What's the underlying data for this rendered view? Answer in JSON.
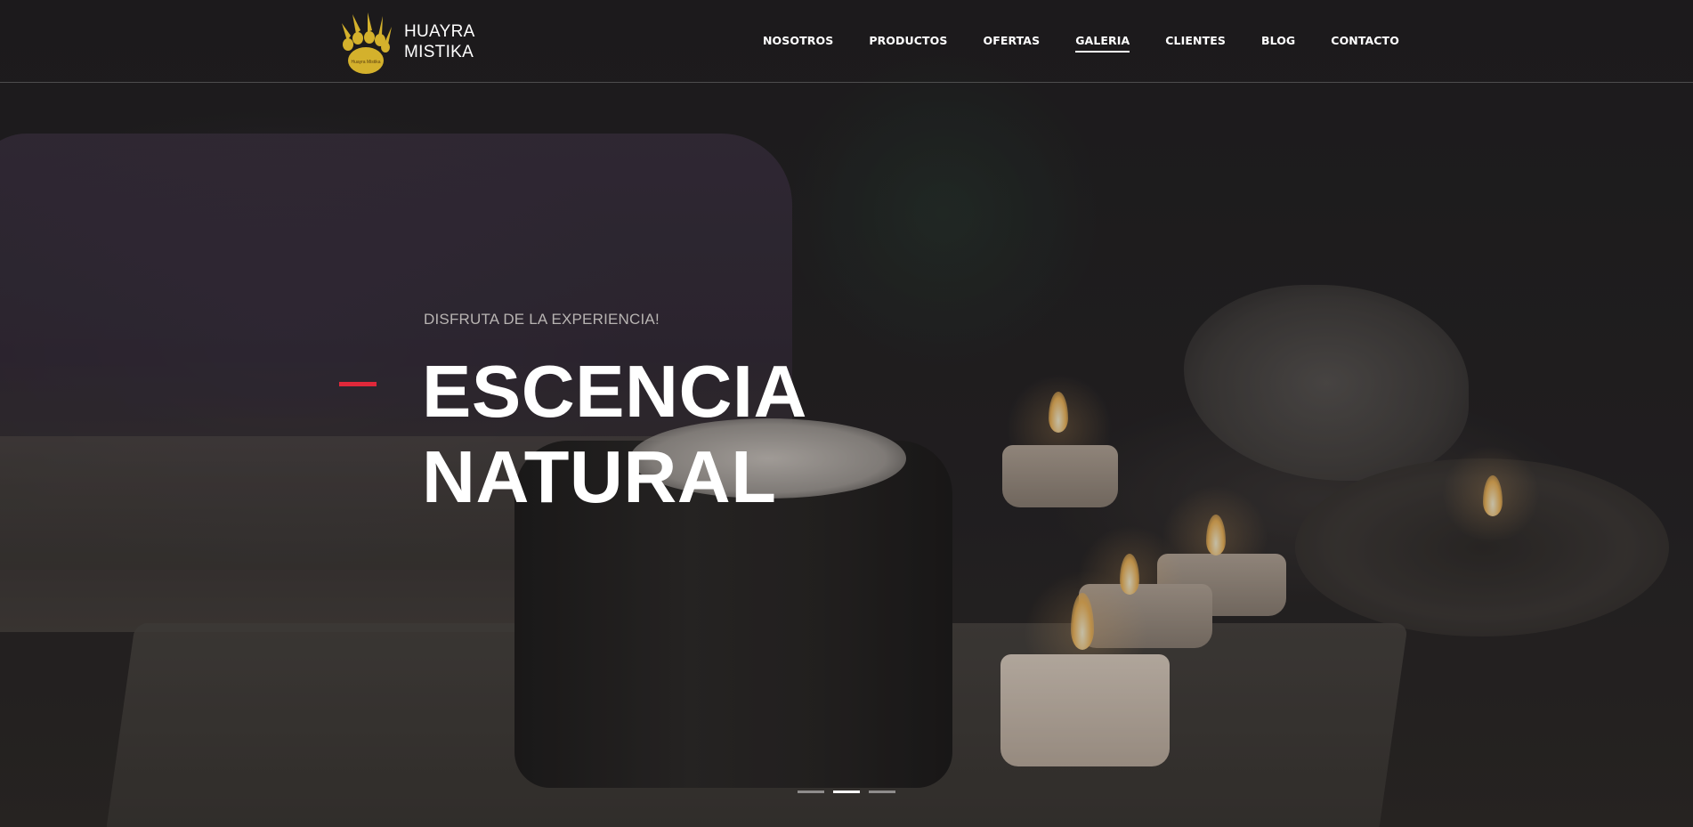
{
  "brand": {
    "line1": "HUAYRA",
    "line2": "MISTIKA",
    "logo_text": "Huayra Mistika",
    "logo_icon": "paw-claw-icon",
    "logo_color": "#d4b12c"
  },
  "nav": {
    "items": [
      {
        "label": "NOSOTROS",
        "active": false
      },
      {
        "label": "PRODUCTOS",
        "active": false
      },
      {
        "label": "OFERTAS",
        "active": false
      },
      {
        "label": "GALERIA",
        "active": true
      },
      {
        "label": "CLIENTES",
        "active": false
      },
      {
        "label": "BLOG",
        "active": false
      },
      {
        "label": "CONTACTO",
        "active": false
      }
    ]
  },
  "hero": {
    "eyebrow": "DISFRUTA DE LA EXPERIENCIA!",
    "title_line1": "ESCENCIA",
    "title_line2": "NATURAL",
    "accent_color": "#e0283a"
  },
  "slider": {
    "slide_count": 3,
    "active_index": 1
  }
}
